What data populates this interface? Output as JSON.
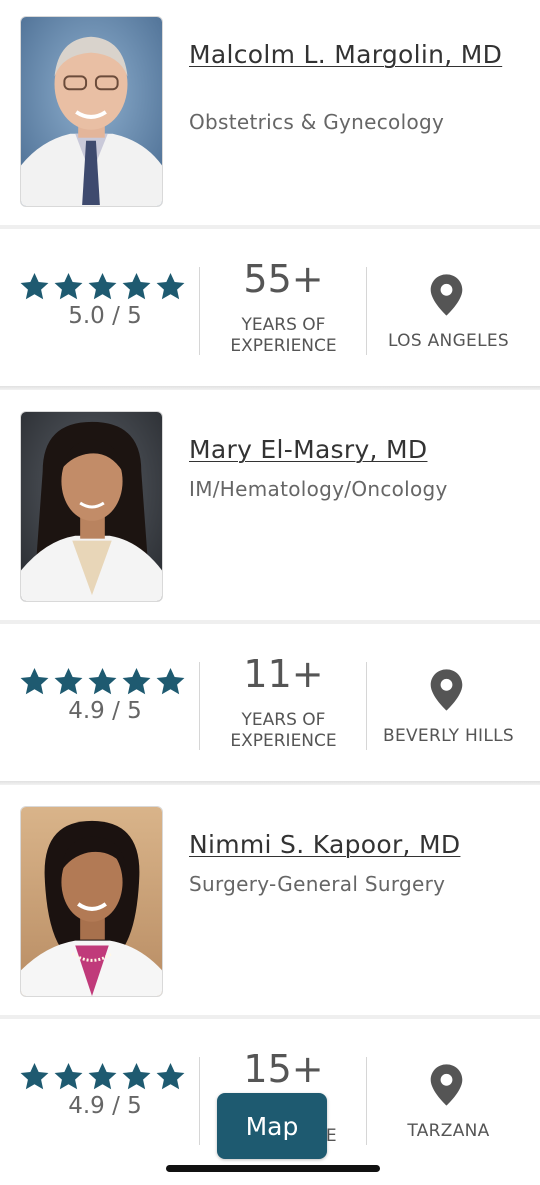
{
  "doctors": [
    {
      "name": "Malcolm L. Margolin, MD",
      "specialty": "Obstetrics & Gynecology",
      "rating": "5.0 / 5",
      "stars": 5,
      "years": "55+",
      "experience_label": "YEARS OF EXPERIENCE",
      "location": "LOS ANGELES"
    },
    {
      "name": "Mary El-Masry, MD",
      "specialty": "IM/Hematology/Oncology",
      "rating": "4.9 / 5",
      "stars": 5,
      "years": "11+",
      "experience_label": "YEARS OF EXPERIENCE",
      "location": "BEVERLY HILLS"
    },
    {
      "name": "Nimmi S. Kapoor, MD",
      "specialty": "Surgery-General Surgery",
      "rating": "4.9 / 5",
      "stars": 5,
      "years": "15+",
      "experience_label": "YEARS OF EXPERIENCE",
      "location": "TARZANA"
    }
  ],
  "map_button": "Map",
  "colors": {
    "star": "#1e5a70",
    "pin": "#555555",
    "map_button": "#1e5a70"
  },
  "icons": {
    "star": "star-icon",
    "location": "map-pin-icon"
  }
}
